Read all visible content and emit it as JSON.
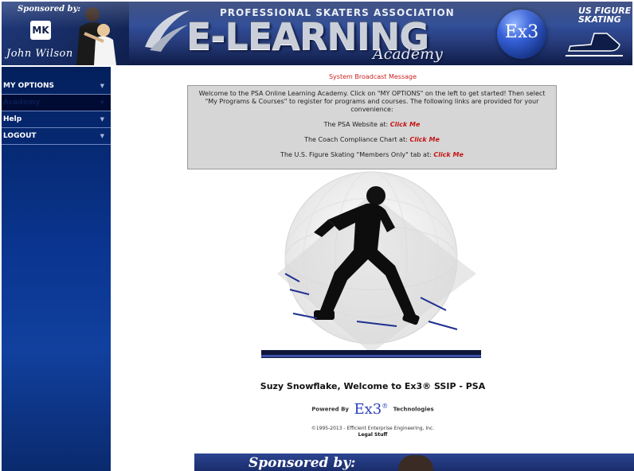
{
  "header": {
    "sponsored_by": "Sponsored by:",
    "mk_logo_text": "MK",
    "sponsor_signature": "John Wilson",
    "organization_line": "PROFESSIONAL SKATERS ASSOCIATION",
    "title": "E-LEARNING",
    "subtitle": "Academy",
    "ex3_logo_text": "Ex3",
    "usfs_logo_text": "US FIGURE SKATING"
  },
  "sidebar": {
    "items": [
      {
        "label": "MY OPTIONS",
        "has_chevron": true,
        "selected": false
      },
      {
        "label": "Academy",
        "has_chevron": true,
        "selected": true
      },
      {
        "label": "Help",
        "has_chevron": true,
        "selected": false
      },
      {
        "label": "LOGOUT",
        "has_chevron": true,
        "selected": false
      }
    ],
    "chevron_glyph": "▼"
  },
  "broadcast": {
    "title": "System Broadcast Message",
    "intro": "Welcome to the PSA Online Learning Academy. Click on \"MY OPTIONS\" on the left to get started! Then select \"My Programs & Courses\" to register for programs and courses. The following links are provided for your convenience:",
    "links": [
      {
        "prefix": "The PSA Website at:",
        "link_text": "Click Me"
      },
      {
        "prefix": "The Coach Compliance Chart at:",
        "link_text": "Click Me"
      },
      {
        "prefix": "The U.S. Figure Skating \"Members Only\" tab at:",
        "link_text": "Click Me"
      }
    ]
  },
  "main": {
    "welcome": "Suzy Snowflake, Welcome to Ex3® SSIP - PSA",
    "powered_by": "Powered By",
    "powered_logo": "Ex3",
    "powered_logo_mark": "®",
    "technologies": "Technologies",
    "copyright": "©1995-2013 - Efficient Enterprise Engineering, Inc.",
    "legal": "Legal Stuff",
    "footer_sponsored": "Sponsored by:"
  },
  "colors": {
    "broadcast_title": "#cc2222",
    "link": "#c41414",
    "sidebar_top": "#03205c",
    "banner": "#2f4d97"
  }
}
